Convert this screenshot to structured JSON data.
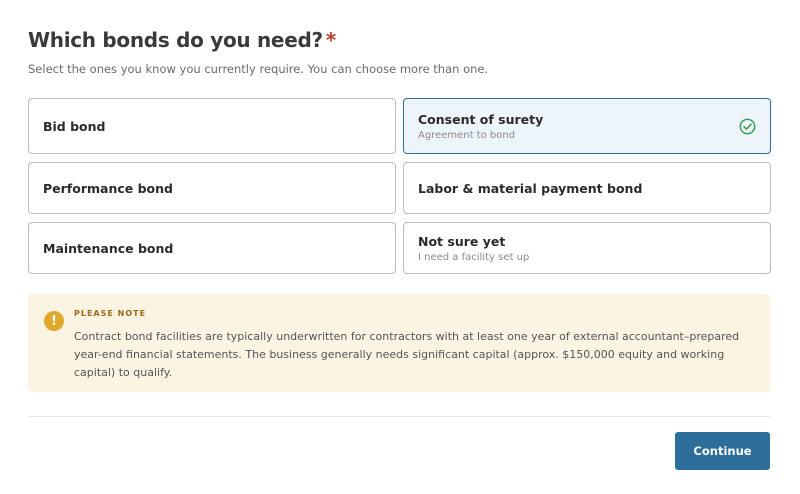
{
  "question": {
    "title": "Which bonds do you need?",
    "required_marker": "*",
    "subtitle": "Select the ones you know you currently require. You can choose more than one."
  },
  "options": [
    {
      "label": "Bid bond",
      "sublabel": "",
      "selected": false
    },
    {
      "label": "Consent of surety",
      "sublabel": "Agreement to bond",
      "selected": true
    },
    {
      "label": "Performance bond",
      "sublabel": "",
      "selected": false
    },
    {
      "label": "Labor & material payment bond",
      "sublabel": "",
      "selected": false
    },
    {
      "label": "Maintenance bond",
      "sublabel": "",
      "selected": false
    },
    {
      "label": "Not sure yet",
      "sublabel": "I need a facility set up",
      "selected": false
    }
  ],
  "note": {
    "icon": "exclamation-icon",
    "icon_glyph": "!",
    "heading": "PLEASE NOTE",
    "body": "Contract bond facilities are typically underwritten for contractors with at least one year of external accountant–prepared year-end financial statements. The business generally needs significant capital (approx. $150,000 equity and working capital) to qualify."
  },
  "actions": {
    "continue_label": "Continue"
  },
  "colors": {
    "accent": "#2d6e9b",
    "selected_border": "#2a6f9e",
    "selected_bg": "#eef5fa",
    "check": "#2e9e4f",
    "required": "#c0392b",
    "note_bg": "#fbf4e2",
    "note_icon": "#e0a92c"
  }
}
